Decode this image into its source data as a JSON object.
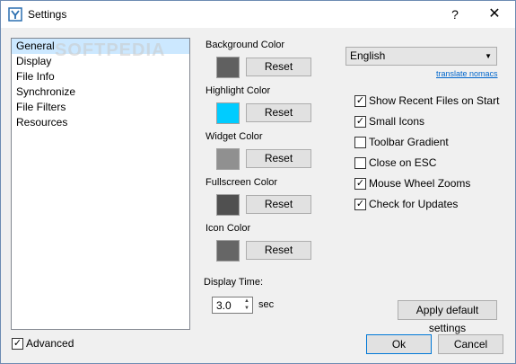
{
  "window": {
    "title": "Settings",
    "help_label": "?",
    "close_label": "✕"
  },
  "nav": {
    "items": [
      "General",
      "Display",
      "File Info",
      "Synchronize",
      "File Filters",
      "Resources"
    ],
    "selected": "General",
    "watermark": "SOFTPEDIA"
  },
  "colors": [
    {
      "label": "Background Color",
      "swatch": "#606060",
      "button": "Reset"
    },
    {
      "label": "Highlight Color",
      "swatch": "#00ccff",
      "button": "Reset"
    },
    {
      "label": "Widget Color",
      "swatch": "#909090",
      "button": "Reset"
    },
    {
      "label": "Fullscreen Color",
      "swatch": "#505050",
      "button": "Reset"
    },
    {
      "label": "Icon Color",
      "swatch": "#666666",
      "button": "Reset"
    }
  ],
  "language": {
    "selected": "English",
    "translate_link": "translate nomacs"
  },
  "options": [
    {
      "label": "Show Recent Files on Start",
      "checked": true
    },
    {
      "label": "Small Icons",
      "checked": true
    },
    {
      "label": "Toolbar Gradient",
      "checked": false
    },
    {
      "label": "Close on ESC",
      "checked": false
    },
    {
      "label": "Mouse Wheel Zooms",
      "checked": true
    },
    {
      "label": "Check for Updates",
      "checked": true
    }
  ],
  "display_time": {
    "label": "Display Time:",
    "value": "3.0",
    "unit": "sec"
  },
  "buttons": {
    "apply_default": "Apply default settings",
    "ok": "Ok",
    "cancel": "Cancel"
  },
  "advanced": {
    "label": "Advanced",
    "checked": true
  }
}
